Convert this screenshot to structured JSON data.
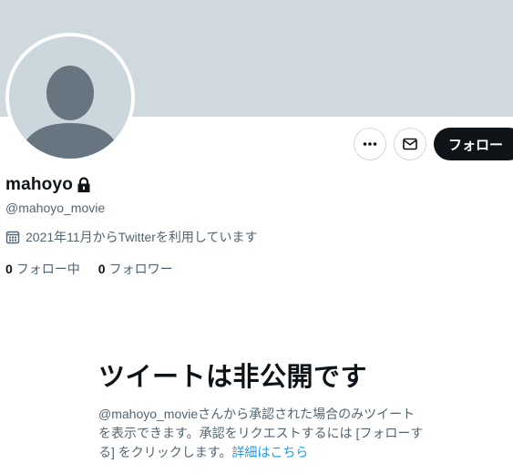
{
  "profile": {
    "display_name": "mahoyo",
    "handle": "@mahoyo_movie",
    "joined": "2021年11月からTwitterを利用しています",
    "following_count": "0",
    "following_label": "フォロー中",
    "followers_count": "0",
    "followers_label": "フォロワー",
    "protected": true
  },
  "actions": {
    "more_icon": "more-horizontal-icon",
    "message_icon": "envelope-icon",
    "follow_label": "フォロー"
  },
  "private_notice": {
    "title": "ツイートは非公開です",
    "description": "@mahoyo_movieさんから承認された場合のみツイートを表示できます。承認をリクエストするには [フォローする] をクリックします。",
    "link_text": "詳細はこちら"
  },
  "colors": {
    "banner": "#cfd9de",
    "avatar_bg": "#ccd6dd",
    "avatar_figure": "#66757f",
    "secondary_text": "#536471",
    "link": "#1d9bf0",
    "follow_button": "#0f1419"
  }
}
